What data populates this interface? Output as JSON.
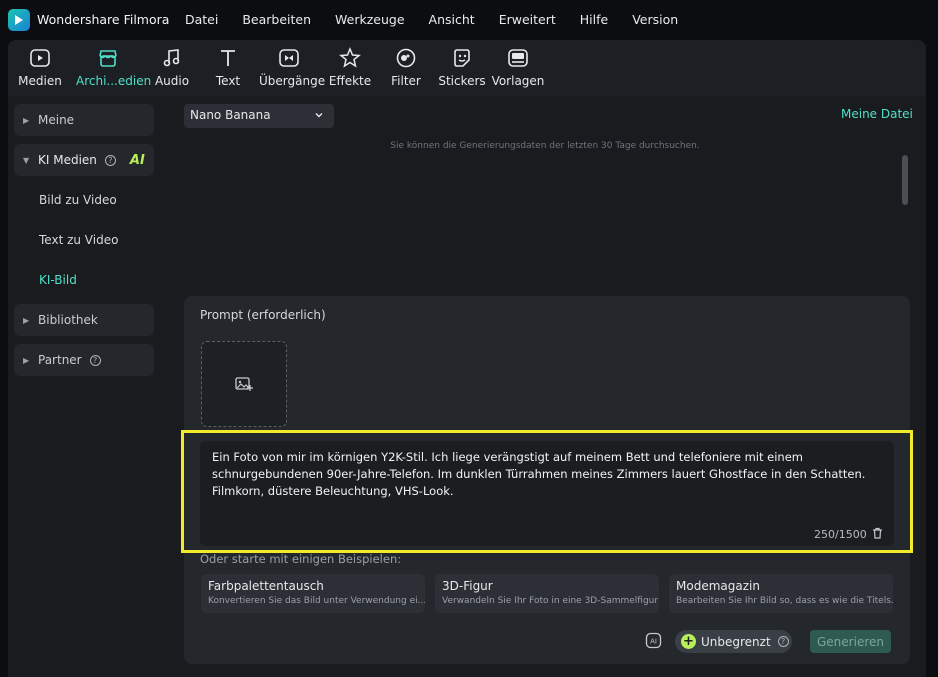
{
  "app": {
    "title": "Wondershare Filmora"
  },
  "menu": [
    "Datei",
    "Bearbeiten",
    "Werkzeuge",
    "Ansicht",
    "Erweitert",
    "Hilfe",
    "Version"
  ],
  "toolbar": [
    {
      "label": "Medien",
      "icon": "media-icon"
    },
    {
      "label": "Archi...edien",
      "icon": "archive-media-icon",
      "active": true
    },
    {
      "label": "Audio",
      "icon": "music-note-icon"
    },
    {
      "label": "Text",
      "icon": "text-icon"
    },
    {
      "label": "Übergänge",
      "icon": "transition-icon"
    },
    {
      "label": "Effekte",
      "icon": "effects-star-icon"
    },
    {
      "label": "Filter",
      "icon": "filter-icon"
    },
    {
      "label": "Stickers",
      "icon": "sticker-icon"
    },
    {
      "label": "Vorlagen",
      "icon": "template-icon"
    }
  ],
  "sidebar": {
    "meine": "Meine",
    "ki_medien": "KI Medien",
    "ai_badge": "AI",
    "sub_items": [
      "Bild zu Video",
      "Text zu Video",
      "KI-Bild"
    ],
    "bibliothek": "Bibliothek",
    "partner": "Partner"
  },
  "content": {
    "model": "Nano Banana",
    "meine_datei": "Meine Datei",
    "hint": "Sie können die Generierungsdaten der letzten 30 Tage durchsuchen."
  },
  "prompt": {
    "title": "Prompt (erforderlich)",
    "text": "Ein Foto von mir im körnigen Y2K-Stil. Ich liege verängstigt auf meinem Bett und telefoniere mit einem schnurgebundenen 90er-Jahre-Telefon. Im dunklen Türrahmen meines Zimmers lauert Ghostface in den Schatten. Filmkorn, düstere Beleuchtung, VHS-Look.",
    "counter": "250/1500"
  },
  "examples": {
    "label": "Oder starte mit einigen Beispielen:",
    "cards": [
      {
        "title": "Farbpalettentausch",
        "desc": "Konvertieren Sie das Bild unter Verwendung ei..."
      },
      {
        "title": "3D-Figur",
        "desc": "Verwandeln Sie Ihr Foto in eine 3D-Sammelfigur"
      },
      {
        "title": "Modemagazin",
        "desc": "Bearbeiten Sie Ihr Bild so, dass es wie die Titels..."
      }
    ]
  },
  "actions": {
    "unlimited": "Unbegrenzt",
    "generate": "Generieren"
  },
  "colors": {
    "accent": "#4fe0c8",
    "ai_green": "#b8f05a",
    "highlight": "#f0ea2a"
  }
}
